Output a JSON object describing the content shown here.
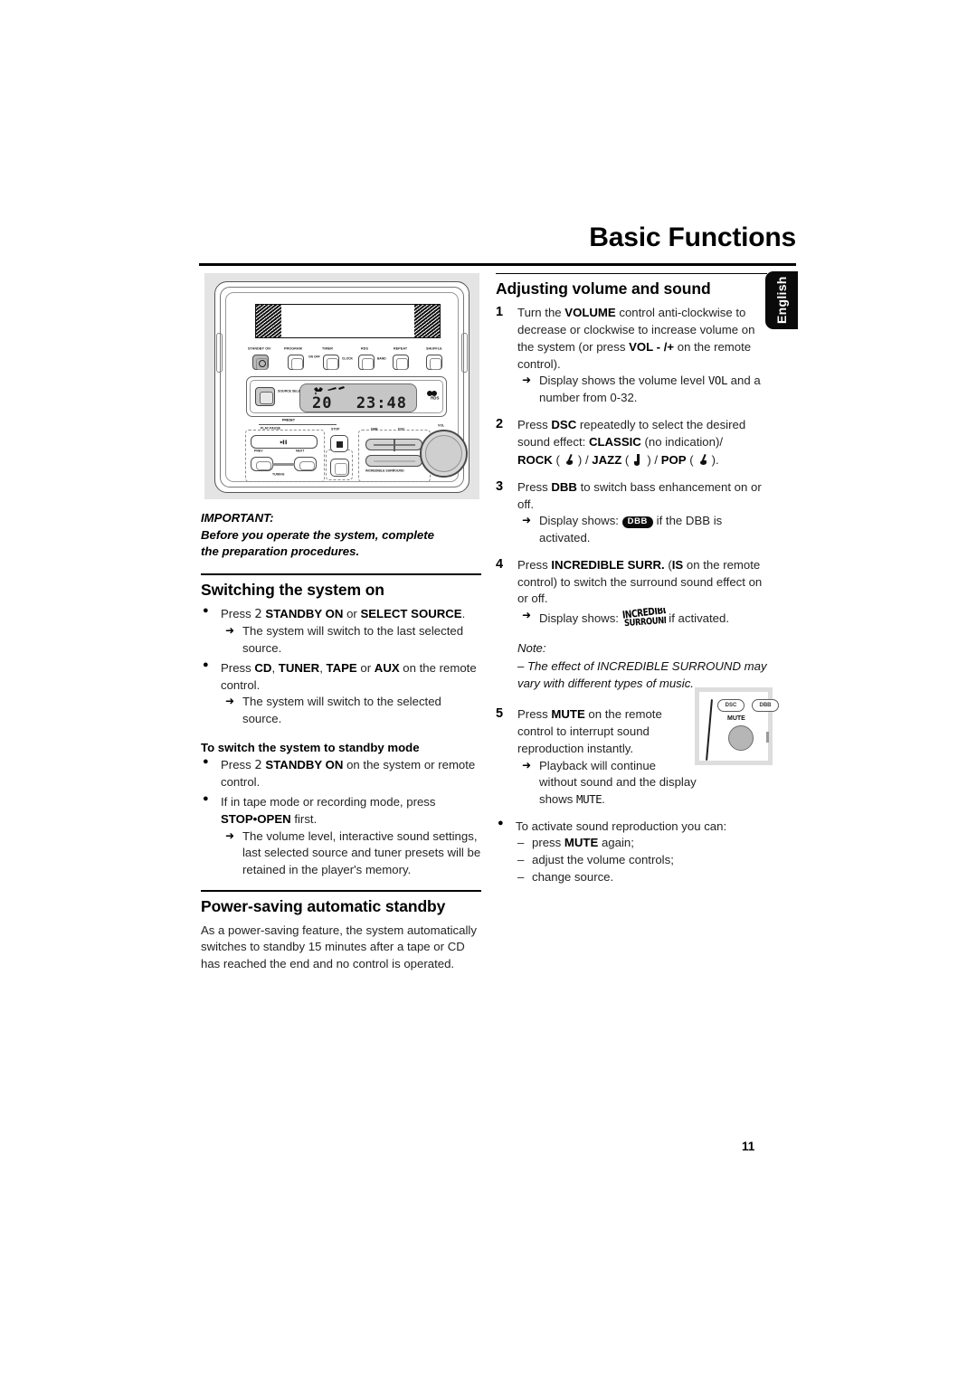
{
  "header": {
    "title": "Basic Functions",
    "language_tab": "English"
  },
  "page_number": "11",
  "illustration": {
    "name": "hi-fi-system-front-panel",
    "top_buttons": [
      {
        "label": "STANDBY ON",
        "icon": "power-icon"
      },
      {
        "label": "PROGRAM"
      },
      {
        "label": "TIMER",
        "sublabel": "ON OFF"
      },
      {
        "label": "RDS",
        "sublabel": "CLOCK"
      },
      {
        "label": "REPEAT",
        "sublabel": "BAND"
      },
      {
        "label": "SHUFFLE"
      }
    ],
    "source_select_label": "SOURCE SELECT",
    "display": {
      "volume_value": "20",
      "time_value": "23:48",
      "cd_logo": "CD RDS"
    },
    "lower_labels": {
      "preset": "PRESET",
      "play_pause": "PLAY·PAUSE",
      "prev": "PREV",
      "next": "NEXT",
      "tuning": "TUNING",
      "stop": "STOP",
      "dbb": "DBB",
      "dsc": "DSC",
      "incredible_surround": "INCREDIBLE SURROUND",
      "vol": "VOL"
    }
  },
  "left_column": {
    "important": {
      "heading": "IMPORTANT:",
      "line1": "Before you operate the system, complete",
      "line2": "the preparation procedures."
    },
    "switching_section": {
      "heading": "Switching the system on",
      "bullet1": {
        "pre": "Press ",
        "b1": "2",
        "mid": "  STANDBY ON",
        "or": " or ",
        "b2": "SELECT SOURCE",
        "post": ".",
        "arrow": "The system will switch to the last selected source."
      },
      "bullet2": {
        "pre": "Press ",
        "b1": "CD",
        "s1": ", ",
        "b2": "TUNER",
        "s2": ", ",
        "b3": "TAPE",
        "s3": " or ",
        "b4": "AUX",
        "post": " on the remote control.",
        "arrow": "The system will switch to the selected source."
      },
      "standby_heading": "To switch the system to standby mode",
      "bullet3": {
        "pre": "Press ",
        "b1": "2",
        "mid": "  STANDBY ON",
        "post": " on the system or remote control."
      },
      "bullet4": {
        "pre": "If in tape mode or recording mode, press ",
        "b1": "STOP•OPEN",
        "post": " first.",
        "arrow": "The volume level, interactive sound settings, last selected source and tuner presets will be retained in the player's memory."
      }
    },
    "power_saving_section": {
      "heading": "Power-saving automatic standby",
      "body": "As a power-saving feature, the system automatically switches to standby 15 minutes after a tape or CD has reached the end and no control is operated."
    }
  },
  "right_column": {
    "heading": "Adjusting volume and sound",
    "step1": {
      "num": "1",
      "t1": "Turn the ",
      "b1": "VOLUME",
      "t2": " control anti-clockwise to decrease or clockwise to increase volume on the system (or press ",
      "b2": "VOL -",
      "t3": "  /+",
      "t4": "   on the remote control).",
      "arrow_pre": "Display shows the volume level ",
      "arrow_lcd": "VOL",
      "arrow_post": " and a number from 0-32."
    },
    "step2": {
      "num": "2",
      "t1": "Press ",
      "b1": "DSC",
      "t2": " repeatedly to select the desired sound effect: ",
      "b2": "CLASSIC",
      "t3": " (no indication)/",
      "effects": "ROCK (   ) / JAZZ (   ) / POP (   ).",
      "rock_label": "ROCK",
      "jazz_label": "JAZZ",
      "pop_label": "POP"
    },
    "step3": {
      "num": "3",
      "t1": "Press ",
      "b1": "DBB",
      "t2": " to switch bass enhancement on or off.",
      "arrow_pre": "Display shows: ",
      "badge": "DBB",
      "arrow_post": " if the DBB is activated."
    },
    "step4": {
      "num": "4",
      "t1": "Press ",
      "b1": "INCREDIBLE SURR.",
      "t2": " (",
      "b2": "IS",
      "t3": " on the remote control) to switch the surround sound effect on or off.",
      "arrow_pre": "Display shows: ",
      "logo_line1": "INCREDIBLE",
      "logo_line2": "SURROUND",
      "arrow_post": " if activated."
    },
    "note": {
      "heading": "Note:",
      "body": "–  The effect of INCREDIBLE SURROUND may vary with different types of music."
    },
    "step5": {
      "num": "5",
      "t1": "Press ",
      "b1": "MUTE",
      "t2": " on the remote control to interrupt sound reproduction instantly.",
      "arrow_pre": "Playback will continue without sound and the display shows ",
      "arrow_lcd": "MUTE",
      "arrow_post": "."
    },
    "bullet": {
      "text": "To activate sound reproduction you can:",
      "items_pre": [
        "press ",
        "adjust the volume controls;",
        "change source."
      ],
      "item1_b": "MUTE",
      "item1_post": " again;"
    },
    "remote_inset": {
      "dsc": "DSC",
      "dbb": "DBB",
      "mute": "MUTE"
    }
  }
}
